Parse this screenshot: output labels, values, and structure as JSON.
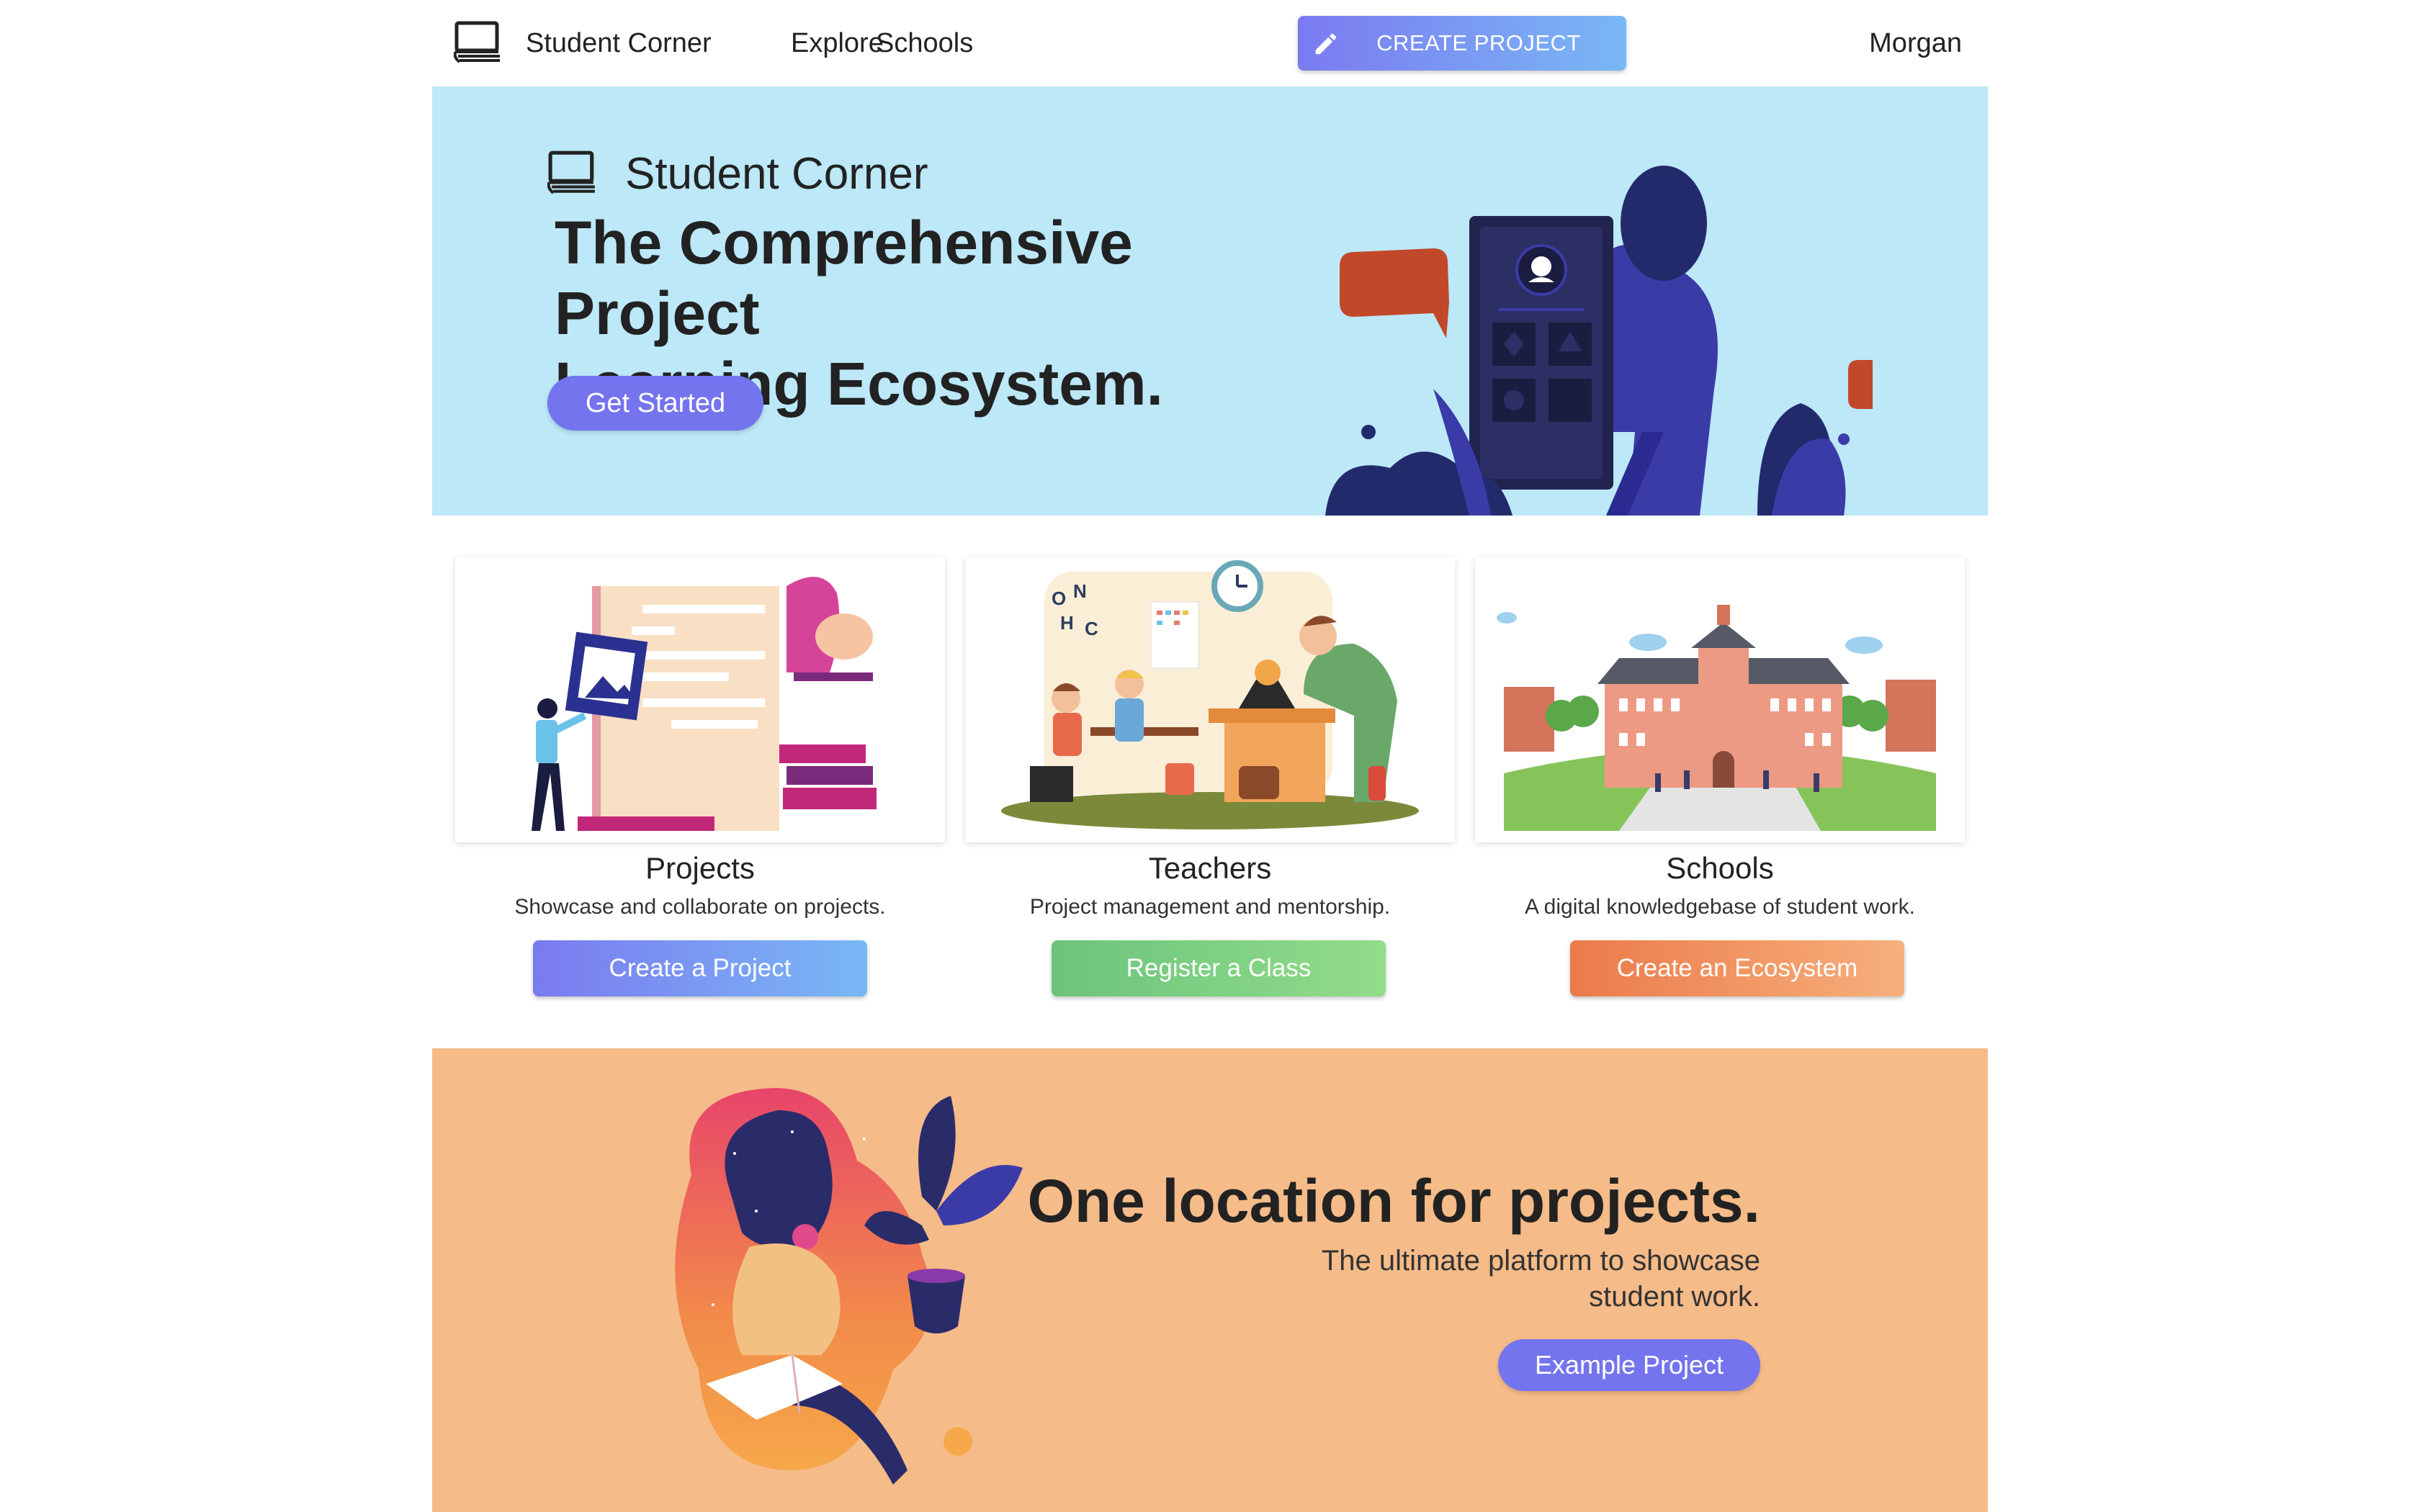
{
  "nav": {
    "brand": "Student Corner",
    "links": [
      "Explore",
      "Schools"
    ],
    "create_label": "CREATE PROJECT",
    "user": "Morgan"
  },
  "hero": {
    "brand": "Student Corner",
    "headline_line1": "The Comprehensive Project",
    "headline_line2": "Learning Ecosystem.",
    "cta": "Get Started"
  },
  "cards": [
    {
      "title": "Projects",
      "subtitle": "Showcase and collaborate on projects.",
      "button": "Create a Project"
    },
    {
      "title": "Teachers",
      "subtitle": "Project management and mentorship.",
      "button": "Register a Class"
    },
    {
      "title": "Schools",
      "subtitle": "A digital knowledgebase of student work.",
      "button": "Create an Ecosystem"
    }
  ],
  "banner": {
    "title": "One location for projects.",
    "subtitle_line1": "The ultimate platform to showcase",
    "subtitle_line2": "student work.",
    "cta": "Example Project"
  },
  "colors": {
    "hero_bg": "#bce8f8",
    "banner_bg": "#f5bb88",
    "primary": "#7474ee",
    "green": "#74cc84",
    "orange": "#f08a52"
  },
  "icons": {
    "logo": "book-stack-icon",
    "create": "pencil-icon"
  }
}
